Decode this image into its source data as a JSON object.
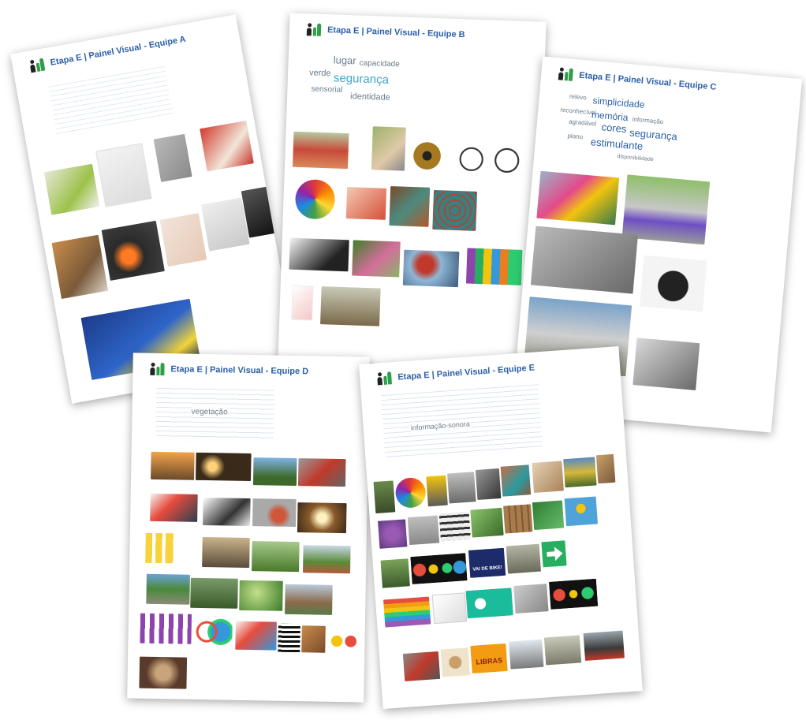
{
  "sheets": {
    "a": {
      "title": "Etapa E | Painel Visual - Equipe A"
    },
    "b": {
      "title": "Etapa E | Painel Visual - Equipe B",
      "words": [
        "lugar",
        "capacidade",
        "verde",
        "segurança",
        "sensorial",
        "identidade"
      ]
    },
    "c": {
      "title": "Etapa E | Painel Visual - Equipe C",
      "words": [
        "relevo",
        "simplicidade",
        "memória",
        "informação",
        "reconhecível",
        "agradável",
        "cores",
        "segurança",
        "plano",
        "estimulante",
        "disponibilidade"
      ]
    },
    "d": {
      "title": "Etapa E | Painel Visual - Equipe D",
      "words": [
        "vegetação"
      ]
    },
    "e": {
      "title": "Etapa E | Painel Visual - Equipe E",
      "words": [
        "informação-sonora"
      ],
      "photo_texts": [
        "VAI DE BIKE!",
        "LIBRAS"
      ]
    }
  },
  "colors": {
    "header_blue": "#2a5fa8",
    "cloud_teal": "#3aa7c9",
    "logo_green": "#2e9e4a",
    "logo_dark": "#222222"
  }
}
